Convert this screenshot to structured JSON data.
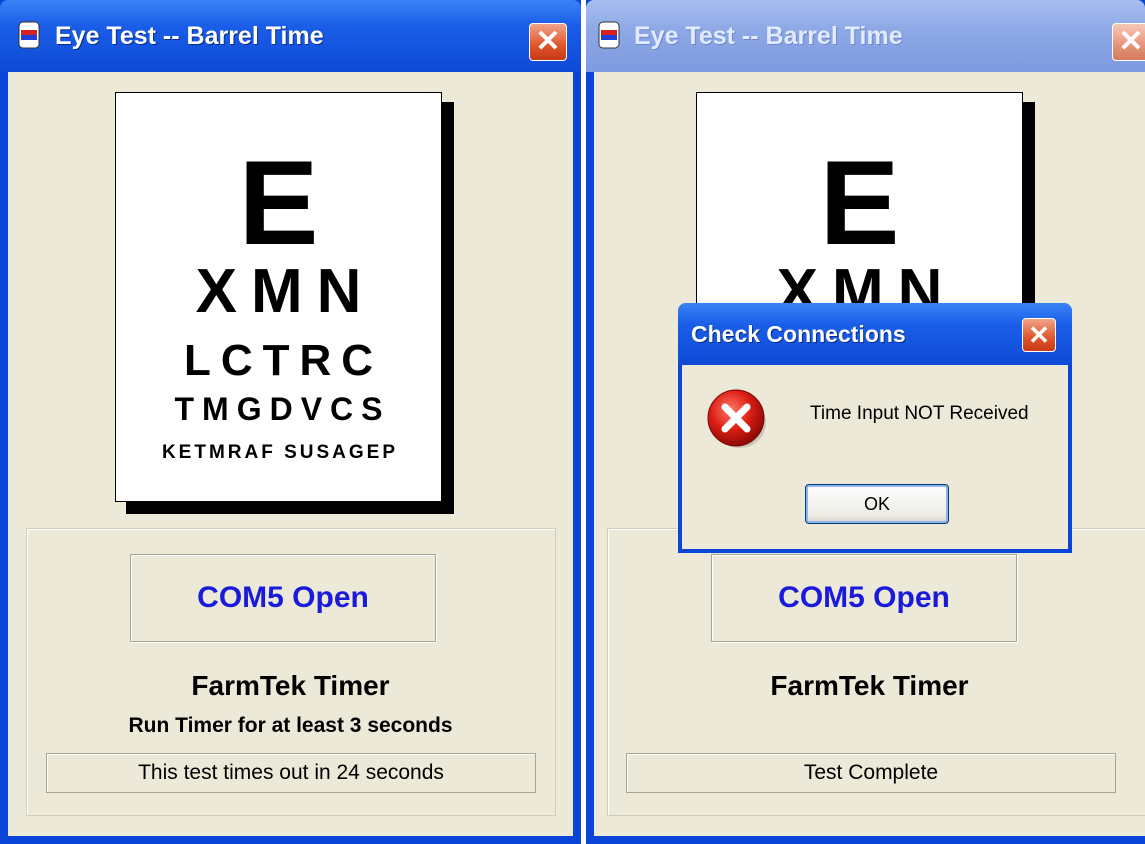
{
  "left_window": {
    "title": "Eye Test -- Barrel Time",
    "eye_chart": {
      "row1": "E",
      "row2": "XMN",
      "row3": "LCTRC",
      "row4": "TMGDVCS",
      "row5": "KETMRAF SUSAGEP"
    },
    "port_status": "COM5 Open",
    "timer_label": "FarmTek Timer",
    "instruction": "Run Timer for at least 3 seconds",
    "status_text": "This test times out in 24 seconds"
  },
  "right_window": {
    "title": "Eye Test -- Barrel Time",
    "eye_chart": {
      "row1": "E",
      "row2": "XMN"
    },
    "port_status": "COM5 Open",
    "timer_label": "FarmTek Timer",
    "status_text": "Test Complete"
  },
  "dialog": {
    "title": "Check Connections",
    "message": "Time Input NOT Received",
    "ok_label": "OK",
    "icon": "error-icon"
  },
  "colors": {
    "titlebar_active": "#0e4ad6",
    "client_bg": "#ece9d8",
    "port_status_text": "#1a1adb"
  }
}
